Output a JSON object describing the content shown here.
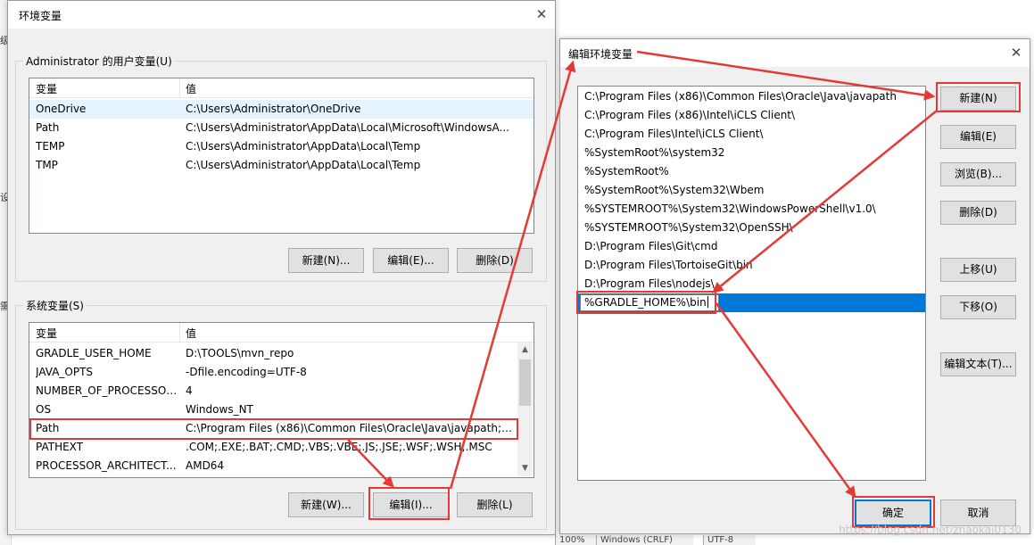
{
  "background": {
    "glyphs": [
      "级",
      "设",
      "需"
    ],
    "status_items": [
      "100%",
      "Windows (CRLF)",
      "UTF-8"
    ]
  },
  "env_dialog": {
    "title": "环境变量",
    "user_group_label": "Administrator 的用户变量(U)",
    "columns": [
      "变量",
      "值"
    ],
    "user_vars": [
      {
        "name": "OneDrive",
        "value": "C:\\Users\\Administrator\\OneDrive"
      },
      {
        "name": "Path",
        "value": "C:\\Users\\Administrator\\AppData\\Local\\Microsoft\\WindowsA..."
      },
      {
        "name": "TEMP",
        "value": "C:\\Users\\Administrator\\AppData\\Local\\Temp"
      },
      {
        "name": "TMP",
        "value": "C:\\Users\\Administrator\\AppData\\Local\\Temp"
      }
    ],
    "user_buttons": {
      "new": "新建(N)...",
      "edit": "编辑(E)...",
      "delete": "删除(D)"
    },
    "system_group_label": "系统变量(S)",
    "system_vars": [
      {
        "name": "GRADLE_USER_HOME",
        "value": "D:\\TOOLS\\mvn_repo"
      },
      {
        "name": "JAVA_OPTS",
        "value": "-Dfile.encoding=UTF-8"
      },
      {
        "name": "NUMBER_OF_PROCESSORS",
        "value": "4"
      },
      {
        "name": "OS",
        "value": "Windows_NT"
      },
      {
        "name": "Path",
        "value": "C:\\Program Files (x86)\\Common Files\\Oracle\\Java\\javapath;C:..."
      },
      {
        "name": "PATHEXT",
        "value": ".COM;.EXE;.BAT;.CMD;.VBS;.VBE;.JS;.JSE;.WSF;.WSH;.MSC"
      },
      {
        "name": "PROCESSOR_ARCHITECT...",
        "value": "AMD64"
      }
    ],
    "system_buttons": {
      "new": "新建(W)...",
      "edit": "编辑(I)...",
      "delete": "删除(L)"
    }
  },
  "edit_dialog": {
    "title": "编辑环境变量",
    "paths": [
      "C:\\Program Files (x86)\\Common Files\\Oracle\\Java\\javapath",
      "C:\\Program Files (x86)\\Intel\\iCLS Client\\",
      "C:\\Program Files\\Intel\\iCLS Client\\",
      "%SystemRoot%\\system32",
      "%SystemRoot%",
      "%SystemRoot%\\System32\\Wbem",
      "%SYSTEMROOT%\\System32\\WindowsPowerShell\\v1.0\\",
      "%SYSTEMROOT%\\System32\\OpenSSH\\",
      "D:\\Program Files\\Git\\cmd",
      "D:\\Program Files\\TortoiseGit\\bin",
      "D:\\Program Files\\nodejs\\"
    ],
    "new_entry": "%GRADLE_HOME%\\bin",
    "buttons": {
      "new": "新建(N)",
      "edit": "编辑(E)",
      "browse": "浏览(B)...",
      "delete": "删除(D)",
      "move_up": "上移(U)",
      "move_down": "下移(O)",
      "edit_text": "编辑文本(T)...",
      "ok": "确定",
      "cancel": "取消"
    }
  },
  "watermark": "https://blog.csdn.net/zhaokai0130",
  "colors": {
    "annotation": "#e53935",
    "selection": "#0078d7",
    "row_highlight": "#e5f3ff"
  }
}
